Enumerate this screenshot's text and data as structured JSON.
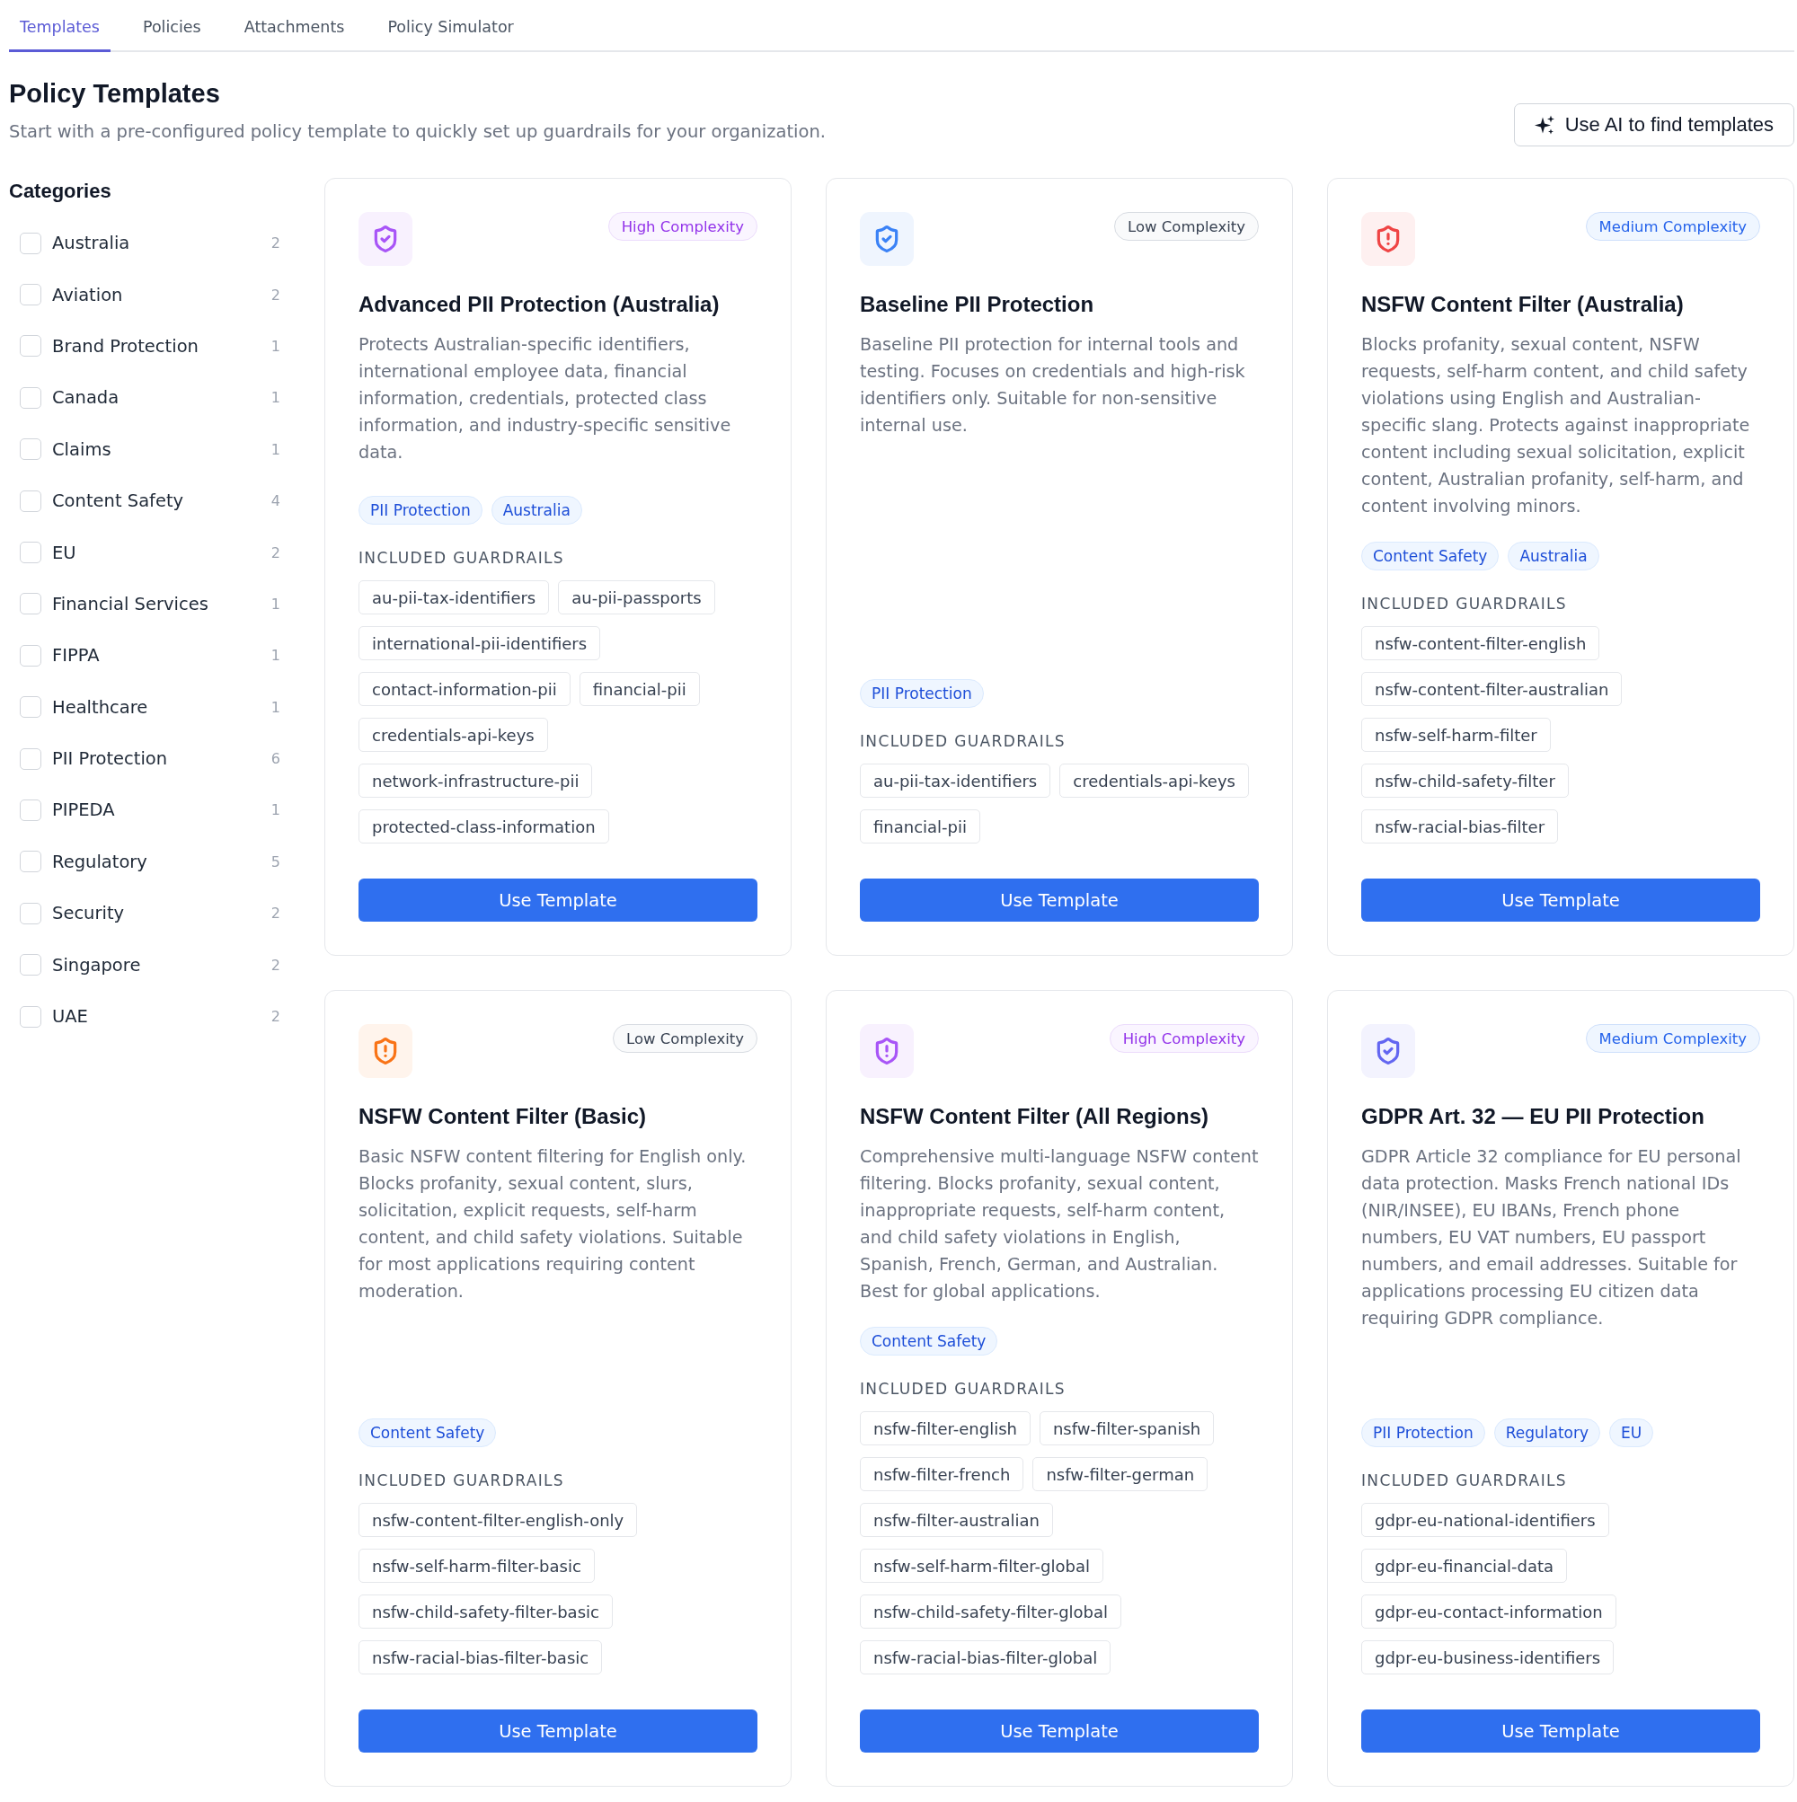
{
  "tabs": [
    {
      "label": "Templates",
      "selected": true
    },
    {
      "label": "Policies",
      "selected": false
    },
    {
      "label": "Attachments",
      "selected": false
    },
    {
      "label": "Policy Simulator",
      "selected": false
    }
  ],
  "header": {
    "title": "Policy Templates",
    "subtitle": "Start with a pre-configured policy template to quickly set up guardrails for your organization.",
    "ai_button": "Use AI to find templates"
  },
  "categories": {
    "heading": "Categories",
    "items": [
      {
        "label": "Australia",
        "count": "2",
        "checked": false
      },
      {
        "label": "Aviation",
        "count": "2",
        "checked": false
      },
      {
        "label": "Brand Protection",
        "count": "1",
        "checked": false
      },
      {
        "label": "Canada",
        "count": "1",
        "checked": false
      },
      {
        "label": "Claims",
        "count": "1",
        "checked": false
      },
      {
        "label": "Content Safety",
        "count": "4",
        "checked": false
      },
      {
        "label": "EU",
        "count": "2",
        "checked": false
      },
      {
        "label": "Financial Services",
        "count": "1",
        "checked": false
      },
      {
        "label": "FIPPA",
        "count": "1",
        "checked": false
      },
      {
        "label": "Healthcare",
        "count": "1",
        "checked": false
      },
      {
        "label": "PII Protection",
        "count": "6",
        "checked": false
      },
      {
        "label": "PIPEDA",
        "count": "1",
        "checked": false
      },
      {
        "label": "Regulatory",
        "count": "5",
        "checked": false
      },
      {
        "label": "Security",
        "count": "2",
        "checked": false
      },
      {
        "label": "Singapore",
        "count": "2",
        "checked": false
      },
      {
        "label": "UAE",
        "count": "2",
        "checked": false
      }
    ]
  },
  "templates": [
    {
      "icon": {
        "kind": "check",
        "color": "#a855f7"
      },
      "complexity": {
        "label": "High Complexity",
        "kind": "high"
      },
      "title": "Advanced PII Protection (Australia)",
      "description": "Protects Australian-specific identifiers, international employee data, financial information, credentials, protected class information, and industry-specific sensitive data.",
      "tags": [
        "PII Protection",
        "Australia"
      ],
      "guardrails_heading": "INCLUDED GUARDRAILS",
      "guardrails": [
        "au-pii-tax-identifiers",
        "au-pii-passports",
        "international-pii-identifiers",
        "contact-information-pii",
        "financial-pii",
        "credentials-api-keys",
        "network-infrastructure-pii",
        "protected-class-information"
      ],
      "button": "Use Template"
    },
    {
      "icon": {
        "kind": "check",
        "color": "#3b82f6"
      },
      "complexity": {
        "label": "Low Complexity",
        "kind": "low"
      },
      "title": "Baseline PII Protection",
      "description": "Baseline PII protection for internal tools and testing. Focuses on credentials and high-risk identifiers only. Suitable for non-sensitive internal use.",
      "tags": [
        "PII Protection"
      ],
      "guardrails_heading": "INCLUDED GUARDRAILS",
      "guardrails": [
        "au-pii-tax-identifiers",
        "credentials-api-keys",
        "financial-pii"
      ],
      "button": "Use Template"
    },
    {
      "icon": {
        "kind": "alert",
        "color": "#ef4444"
      },
      "complexity": {
        "label": "Medium Complexity",
        "kind": "medium"
      },
      "title": "NSFW Content Filter (Australia)",
      "description": "Blocks profanity, sexual content, NSFW requests, self-harm content, and child safety violations using English and Australian-specific slang. Protects against inappropriate content including sexual solicitation, explicit content, Australian profanity, self-harm, and content involving minors.",
      "tags": [
        "Content Safety",
        "Australia"
      ],
      "guardrails_heading": "INCLUDED GUARDRAILS",
      "guardrails": [
        "nsfw-content-filter-english",
        "nsfw-content-filter-australian",
        "nsfw-self-harm-filter",
        "nsfw-child-safety-filter",
        "nsfw-racial-bias-filter"
      ],
      "button": "Use Template"
    },
    {
      "icon": {
        "kind": "alert",
        "color": "#f97316"
      },
      "complexity": {
        "label": "Low Complexity",
        "kind": "low"
      },
      "title": "NSFW Content Filter (Basic)",
      "description": "Basic NSFW content filtering for English only. Blocks profanity, sexual content, slurs, solicitation, explicit requests, self-harm content, and child safety violations. Suitable for most applications requiring content moderation.",
      "tags": [
        "Content Safety"
      ],
      "guardrails_heading": "INCLUDED GUARDRAILS",
      "guardrails": [
        "nsfw-content-filter-english-only",
        "nsfw-self-harm-filter-basic",
        "nsfw-child-safety-filter-basic",
        "nsfw-racial-bias-filter-basic"
      ],
      "button": "Use Template"
    },
    {
      "icon": {
        "kind": "alert",
        "color": "#a855f7"
      },
      "complexity": {
        "label": "High Complexity",
        "kind": "high"
      },
      "title": "NSFW Content Filter (All Regions)",
      "description": "Comprehensive multi-language NSFW content filtering. Blocks profanity, sexual content, inappropriate requests, self-harm content, and child safety violations in English, Spanish, French, German, and Australian. Best for global applications.",
      "tags": [
        "Content Safety"
      ],
      "guardrails_heading": "INCLUDED GUARDRAILS",
      "guardrails": [
        "nsfw-filter-english",
        "nsfw-filter-spanish",
        "nsfw-filter-french",
        "nsfw-filter-german",
        "nsfw-filter-australian",
        "nsfw-self-harm-filter-global",
        "nsfw-child-safety-filter-global",
        "nsfw-racial-bias-filter-global"
      ],
      "button": "Use Template"
    },
    {
      "icon": {
        "kind": "check",
        "color": "#6366f1"
      },
      "complexity": {
        "label": "Medium Complexity",
        "kind": "medium"
      },
      "title": "GDPR Art. 32 — EU PII Protection",
      "description": "GDPR Article 32 compliance for EU personal data protection. Masks French national IDs (NIR/INSEE), EU IBANs, French phone numbers, EU VAT numbers, EU passport numbers, and email addresses. Suitable for applications processing EU citizen data requiring GDPR compliance.",
      "tags": [
        "PII Protection",
        "Regulatory",
        "EU"
      ],
      "guardrails_heading": "INCLUDED GUARDRAILS",
      "guardrails": [
        "gdpr-eu-national-identifiers",
        "gdpr-eu-financial-data",
        "gdpr-eu-contact-information",
        "gdpr-eu-business-identifiers"
      ],
      "button": "Use Template"
    }
  ]
}
